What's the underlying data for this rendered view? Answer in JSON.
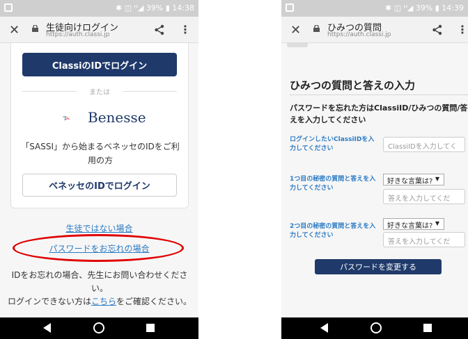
{
  "left_phone": {
    "status": {
      "right_text": "✱ ◫ ᴴ◢ 39% ▮ 14:38"
    },
    "browser": {
      "title": "生徒向けログイン",
      "url": "https://auth.classi.jp"
    },
    "classi_button_label": "ClassiのIDでログイン",
    "or_label": "または",
    "benesse_brand": "Benesse",
    "sassi_description": "「SASSI」から始まるベネッセのIDをご利用の方",
    "benesse_button_label": "ベネッセのIDでログイン",
    "not_student_link": "生徒ではない場合",
    "forgot_password_link": "パスワードをお忘れの場合",
    "forgot_id_text": "IDをお忘れの場合、先生にお問い合わせください。",
    "cant_login_prefix": "ログインできない方は",
    "cant_login_link": "こちら",
    "cant_login_suffix": "をご確認ください。"
  },
  "right_phone": {
    "status": {
      "right_text": "✱ ◫ ᴴ◢ 39% ▮ 14:39"
    },
    "browser": {
      "title": "ひみつの質問",
      "url": "https://auth.classi.jp"
    },
    "heading": "ひみつの質問と答えの入力",
    "intro": "パスワードを忘れた方はClassiID/ひみつの質問/答えを入力してください",
    "classi_id_label": "ログインしたいClassiIDを入力してください",
    "classi_id_placeholder": "ClassiIDを入力してく",
    "q1_label": "1つ目の秘密の質問と答えを入力してください",
    "q1_select": "好きな言葉は?",
    "q1_placeholder": "答えを入力してくだ",
    "q2_label": "2つ目の秘密の質問と答えを入力してください",
    "q2_select": "好きな言葉は?",
    "q2_placeholder": "答えを入力してくだ",
    "change_button_label": "パスワードを変更する"
  },
  "colors": {
    "brand_navy": "#1f3a6a",
    "link_blue": "#2a7ac4",
    "highlight_red": "#e00000"
  }
}
